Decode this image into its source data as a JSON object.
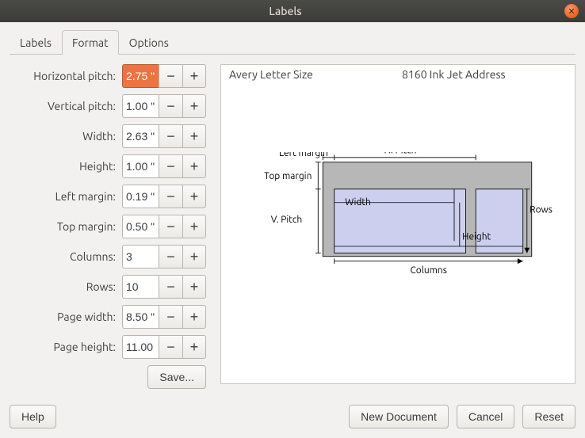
{
  "window": {
    "title": "Labels"
  },
  "tabs": {
    "labels": "Labels",
    "format": "Format",
    "options": "Options"
  },
  "fields": {
    "hpitch": {
      "label": "Horizontal pitch:",
      "value": "2.75 \""
    },
    "vpitch": {
      "label": "Vertical pitch:",
      "value": "1.00 \""
    },
    "width": {
      "label": "Width:",
      "value": "2.63 \""
    },
    "height": {
      "label": "Height:",
      "value": "1.00 \""
    },
    "lmargin": {
      "label": "Left margin:",
      "value": "0.19 \""
    },
    "tmargin": {
      "label": "Top margin:",
      "value": "0.50 \""
    },
    "cols": {
      "label": "Columns:",
      "value": "3"
    },
    "rows": {
      "label": "Rows:",
      "value": "10"
    },
    "pwidth": {
      "label": "Page width:",
      "value": "8.50 \""
    },
    "pheight": {
      "label": "Page height:",
      "value": "11.00 \""
    }
  },
  "save_button": "Save...",
  "preview": {
    "brand": "Avery Letter Size",
    "type": "8160 Ink Jet Address",
    "labels": {
      "left_margin": "Left margin",
      "top_margin": "Top margin",
      "hpitch": "H. Pitch",
      "vpitch": "V. Pitch",
      "width": "Width",
      "height": "Height",
      "columns": "Columns",
      "rows": "Rows"
    }
  },
  "buttons": {
    "help": "Help",
    "new_document": "New Document",
    "cancel": "Cancel",
    "reset": "Reset"
  },
  "glyphs": {
    "minus": "−",
    "plus": "+",
    "close": "✕"
  }
}
